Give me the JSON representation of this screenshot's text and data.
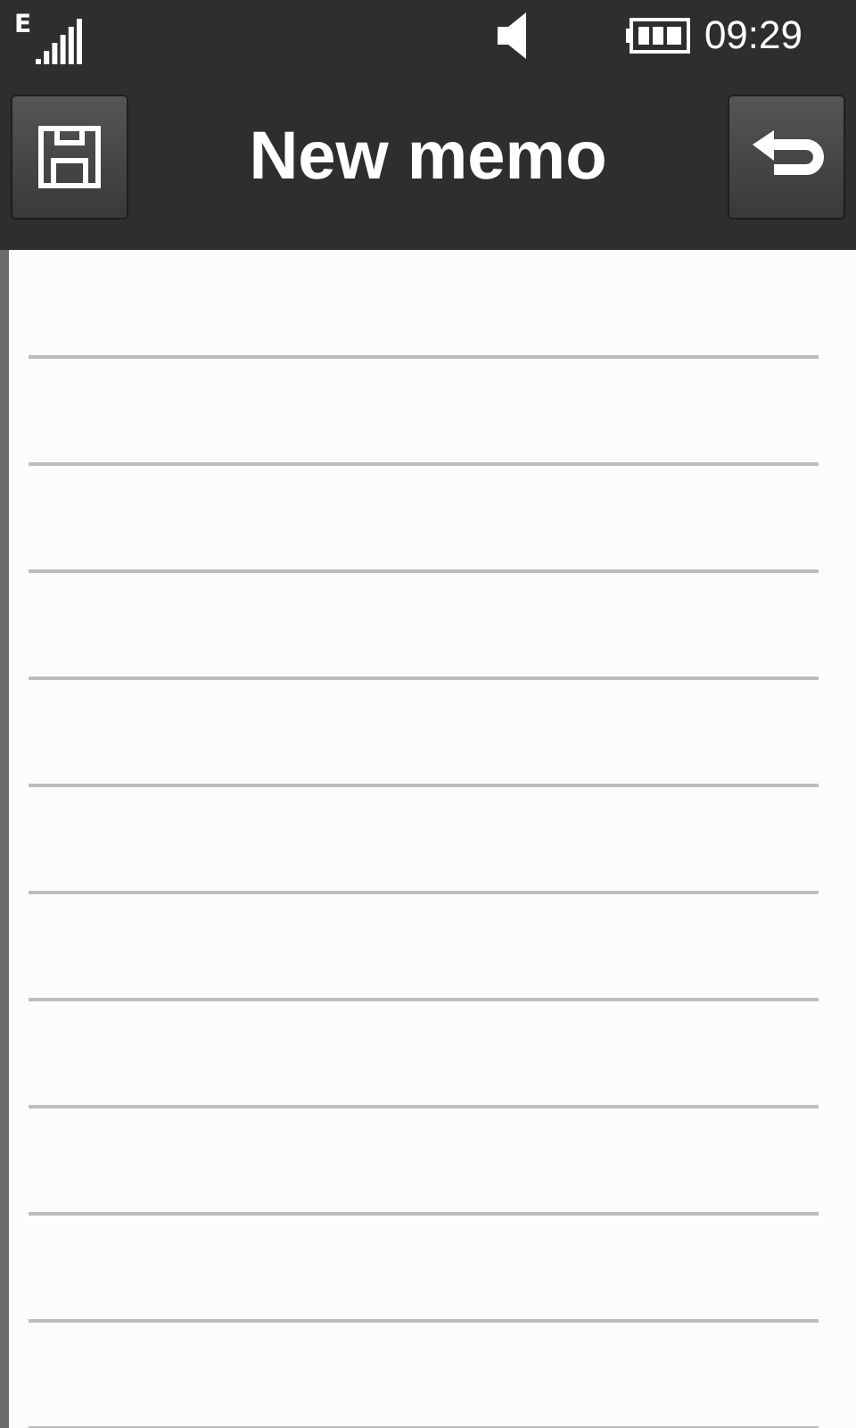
{
  "status_bar": {
    "network": "E",
    "time": "09:29"
  },
  "header": {
    "title": "New memo"
  }
}
